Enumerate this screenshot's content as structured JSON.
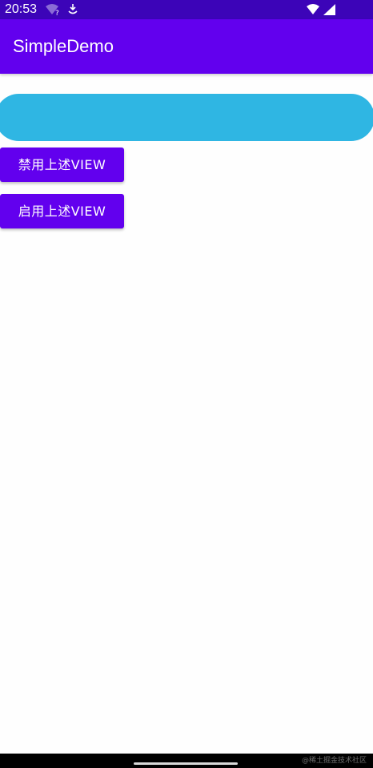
{
  "status_bar": {
    "time": "20:53",
    "icons": [
      "wifi-question-icon",
      "download-icon",
      "wifi-exclamation-icon",
      "cellular-signal-icon"
    ],
    "background": "#3c04b8"
  },
  "app_bar": {
    "title": "SimpleDemo",
    "background": "#6200ee"
  },
  "custom_view": {
    "color": "#2fb6e3"
  },
  "buttons": {
    "disable_label": "禁用上述VIEW",
    "enable_label": "启用上述VIEW",
    "color": "#6200ee"
  },
  "navigation_bar": {
    "watermark": "@稀土掘金技术社区"
  }
}
